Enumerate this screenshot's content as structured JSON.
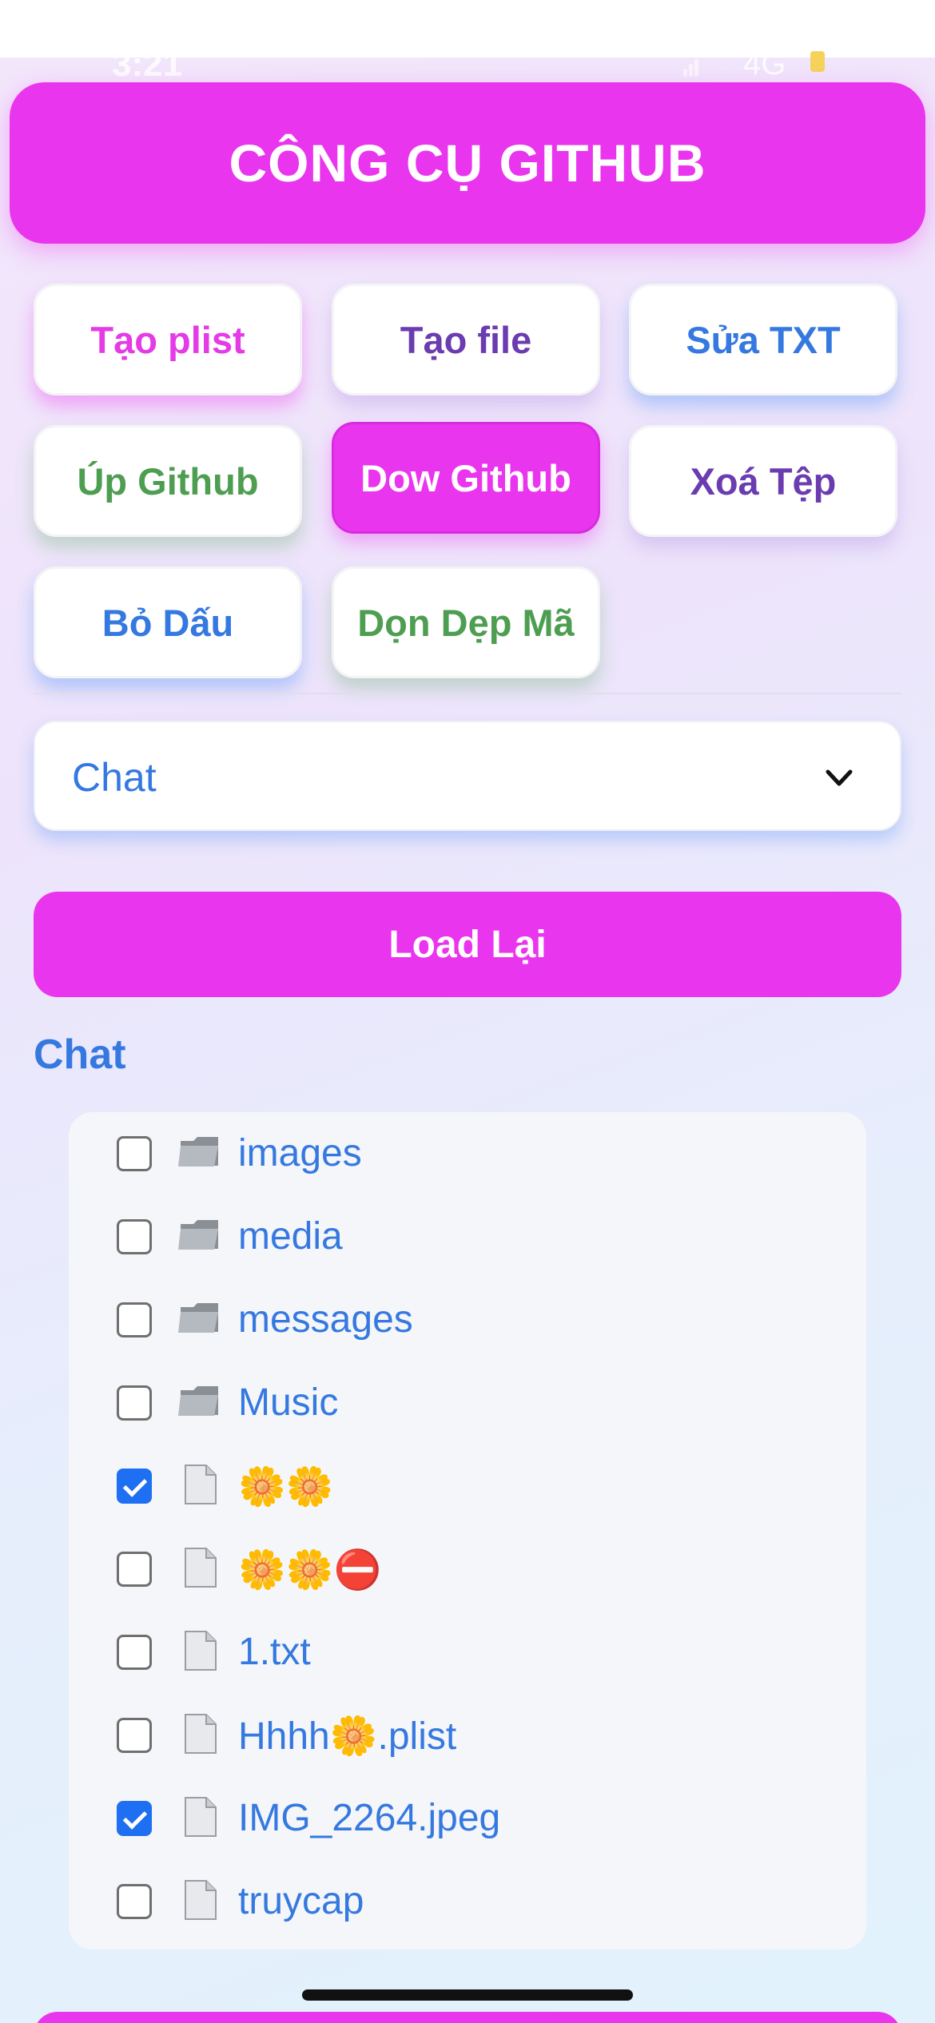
{
  "status": {
    "time": "3:21",
    "network": "4G"
  },
  "header": {
    "title": "CÔNG CỤ GITHUB"
  },
  "tools": [
    {
      "label": "Tạo plist",
      "color": "#e43be6"
    },
    {
      "label": "Tạo file",
      "color": "#6b3cb0"
    },
    {
      "label": "Sửa TXT",
      "color": "#3579e0"
    },
    {
      "label": "Úp Github",
      "color": "#4e9e52"
    },
    {
      "label": "Dow Github",
      "color": "#ffffff",
      "active": true
    },
    {
      "label": "Xoá Tệp",
      "color": "#6b3cb0"
    },
    {
      "label": "Bỏ Dấu",
      "color": "#3579e0"
    },
    {
      "label": "Dọn Dẹp Mã",
      "color": "#4e9e52"
    }
  ],
  "repo_select": {
    "value": "Chat",
    "icon": "chevron-down-icon"
  },
  "reload_button": {
    "label": "Load Lại"
  },
  "section": {
    "title": "Chat"
  },
  "files": [
    {
      "name": "images",
      "type": "folder",
      "checked": false
    },
    {
      "name": "media",
      "type": "folder",
      "checked": false
    },
    {
      "name": "messages",
      "type": "folder",
      "checked": false
    },
    {
      "name": "Music",
      "type": "folder",
      "checked": false
    },
    {
      "name": "🌼🌼",
      "type": "file",
      "checked": true
    },
    {
      "name": "🌼🌼⛔",
      "type": "file",
      "checked": false
    },
    {
      "name": "1.txt",
      "type": "file",
      "checked": false
    },
    {
      "name": "Hhhh🌼.plist",
      "type": "file",
      "checked": false
    },
    {
      "name": "IMG_2264.jpeg",
      "type": "file",
      "checked": true
    },
    {
      "name": "truycap",
      "type": "file",
      "checked": false
    }
  ],
  "colors": {
    "accent": "#ea35ee",
    "link": "#3579e0",
    "checkbox": "#1f6ff2"
  }
}
